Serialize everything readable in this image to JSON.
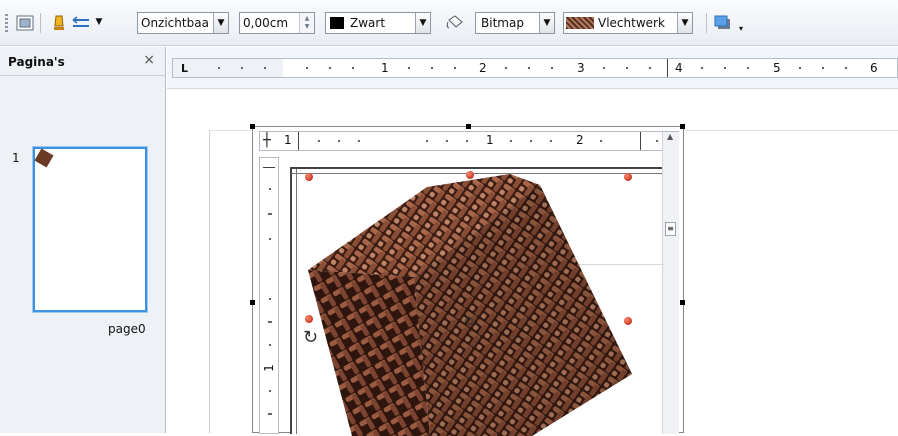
{
  "toolbar": {
    "line_style": "Onzichtbaa",
    "line_width": "0,00cm",
    "line_color": {
      "label": "Zwart",
      "swatch": "#000000"
    },
    "area_style": "Bitmap",
    "area_fill": {
      "label": "Vlechtwerk",
      "swatch": "#6e3d2c"
    }
  },
  "pages_panel": {
    "title": "Pagina's",
    "close": "×",
    "page_number": "1",
    "page_name": "page0"
  },
  "main_ruler": {
    "tab_marker": "L",
    "numbers": [
      "1",
      "2",
      "3",
      "4",
      "5",
      "6"
    ]
  },
  "inner_ruler": {
    "numbers": [
      "1",
      "1",
      "2"
    ],
    "vertical_number": "1"
  },
  "colors": {
    "selection": "#3b92e2",
    "handle": "#c0200e",
    "cube": "#7a4633"
  }
}
